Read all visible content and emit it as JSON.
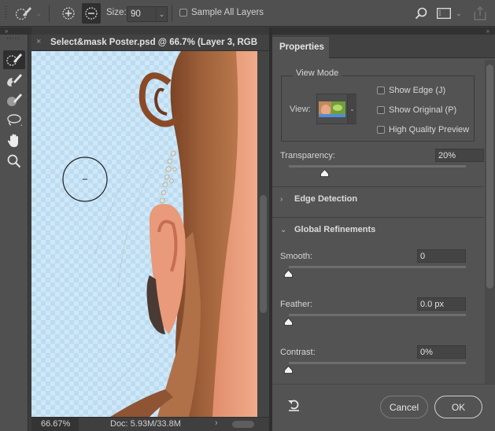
{
  "options_bar": {
    "active_tool_icon": "quick-selection-brush-icon",
    "add_mode_icon": "add-to-selection-icon",
    "subtract_mode_icon": "subtract-from-selection-icon",
    "size_label": "Size:",
    "size_value": "90",
    "sample_all_layers_label": "Sample All Layers",
    "sample_all_layers_checked": false,
    "search_icon": "search-icon",
    "workspace_icon": "workspace-icon",
    "share_icon": "share-icon"
  },
  "toolbox": {
    "tools": [
      {
        "name": "quick-selection-tool",
        "active": true
      },
      {
        "name": "refine-edge-brush-tool",
        "active": false
      },
      {
        "name": "brush-tool",
        "active": false
      },
      {
        "name": "lasso-tool",
        "active": false
      },
      {
        "name": "hand-tool",
        "active": false
      },
      {
        "name": "zoom-tool",
        "active": false
      }
    ]
  },
  "document": {
    "close_glyph": "×",
    "title": "Select&mask Poster.psd @ 66.7% (Layer 3, RGB",
    "status_zoom": "66.67%",
    "status_doc": "Doc: 5.93M/33.8M",
    "status_more": "›"
  },
  "properties": {
    "tab_label": "Properties",
    "view_mode": {
      "legend": "View Mode",
      "view_label": "View:",
      "show_edge_label": "Show Edge (J)",
      "show_edge_checked": false,
      "show_original_label": "Show Original (P)",
      "show_original_checked": false,
      "high_quality_label": "High Quality Preview",
      "high_quality_checked": false
    },
    "transparency": {
      "label": "Transparency:",
      "value": "20%",
      "fraction": 0.2
    },
    "edge_detection": {
      "label": "Edge Detection",
      "expanded": false,
      "chevron": "›"
    },
    "global_refinements": {
      "label": "Global Refinements",
      "expanded": true,
      "chevron": "⌄",
      "smooth": {
        "label": "Smooth:",
        "value": "0",
        "fraction": 0
      },
      "feather": {
        "label": "Feather:",
        "value": "0.0 px",
        "fraction": 0
      },
      "contrast": {
        "label": "Contrast:",
        "value": "0%",
        "fraction": 0
      }
    },
    "reset_icon": "reset-icon",
    "cancel_label": "Cancel",
    "ok_label": "OK"
  },
  "colors": {
    "panel_bg": "#535353",
    "canvas_checker_light": "#cfe7f7",
    "canvas_checker_dark": "#bcdcf1",
    "hair": "#9a5a34",
    "skin": "#e8a07e"
  }
}
